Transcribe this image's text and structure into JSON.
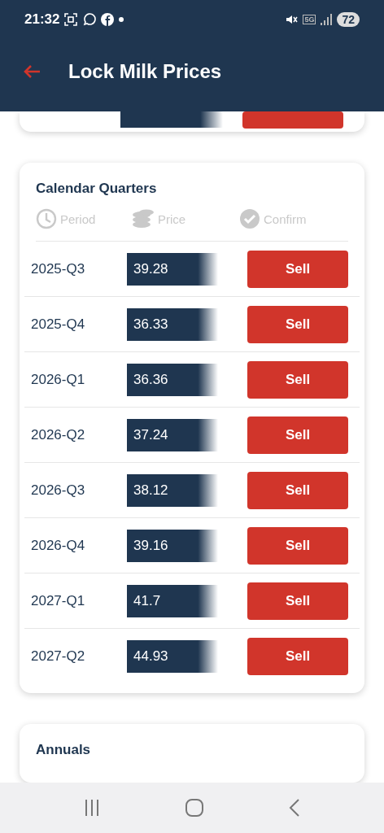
{
  "status_bar": {
    "time": "21:32",
    "network": "5G",
    "battery": "72"
  },
  "app_bar": {
    "title": "Lock Milk Prices"
  },
  "calendar_quarters": {
    "title": "Calendar Quarters",
    "columns": [
      "Period",
      "Price",
      "Confirm"
    ],
    "rows": [
      {
        "period": "2025-Q3",
        "price": "39.28",
        "action": "Sell"
      },
      {
        "period": "2025-Q4",
        "price": "36.33",
        "action": "Sell"
      },
      {
        "period": "2026-Q1",
        "price": "36.36",
        "action": "Sell"
      },
      {
        "period": "2026-Q2",
        "price": "37.24",
        "action": "Sell"
      },
      {
        "period": "2026-Q3",
        "price": "38.12",
        "action": "Sell"
      },
      {
        "period": "2026-Q4",
        "price": "39.16",
        "action": "Sell"
      },
      {
        "period": "2027-Q1",
        "price": "41.7",
        "action": "Sell"
      },
      {
        "period": "2027-Q2",
        "price": "44.93",
        "action": "Sell"
      }
    ]
  },
  "annuals": {
    "title": "Annuals"
  }
}
